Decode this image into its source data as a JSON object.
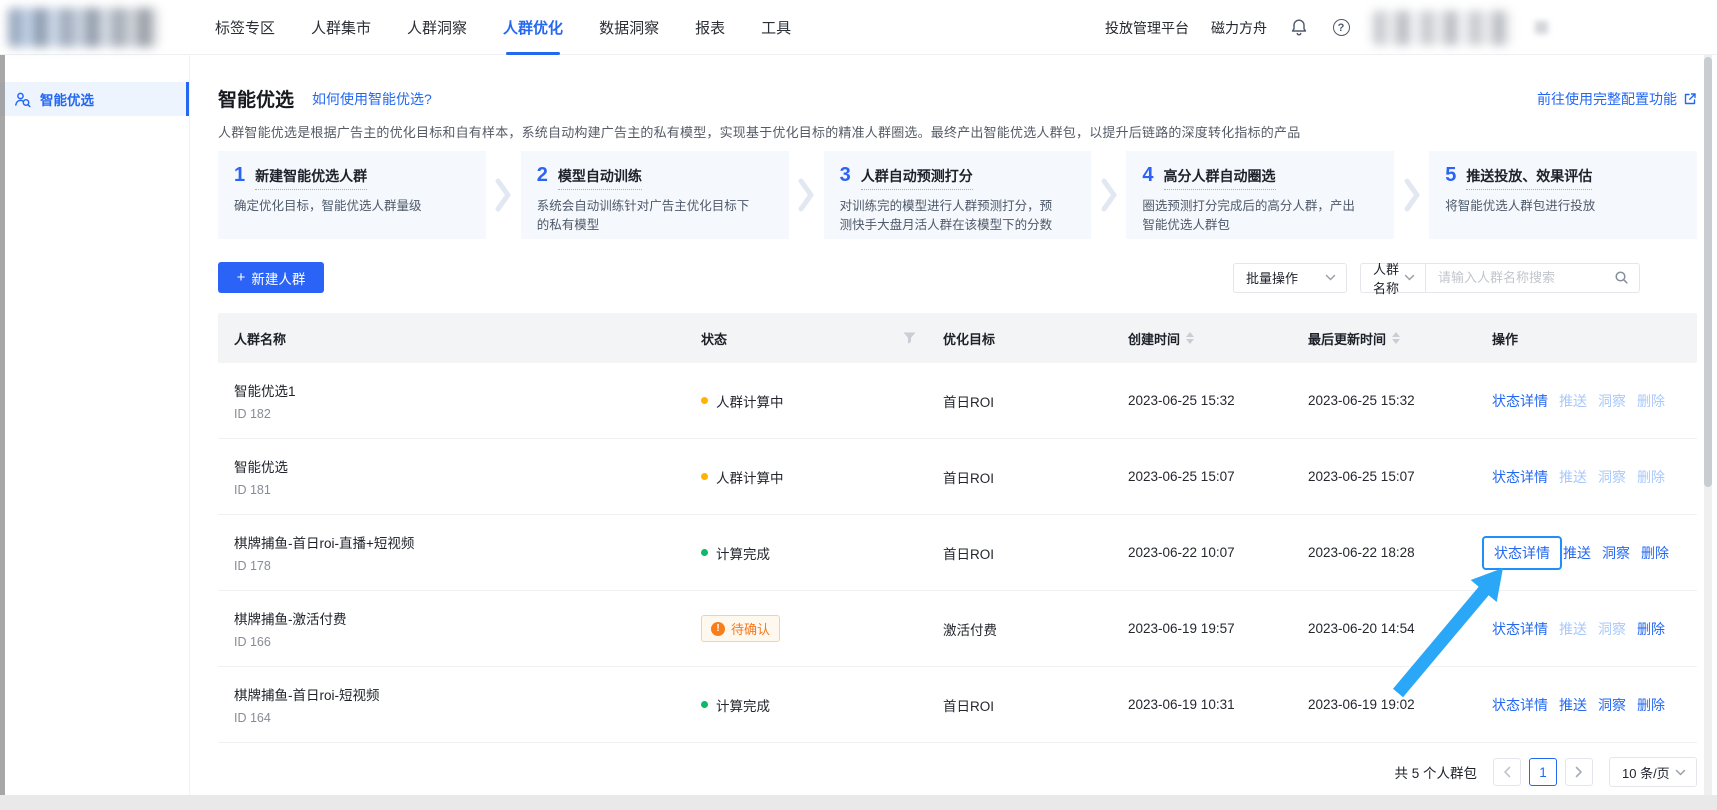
{
  "nav": {
    "tabs": [
      "标签专区",
      "人群集市",
      "人群洞察",
      "人群优化",
      "数据洞察",
      "报表",
      "工具"
    ],
    "active_index": 3,
    "platform_links": [
      "投放管理平台",
      "磁力方舟"
    ],
    "icons": {
      "notification": "bell",
      "help": "question-circle"
    }
  },
  "sidebar": {
    "items": [
      {
        "label": "智能优选",
        "active": true
      }
    ]
  },
  "main": {
    "title": "智能优选",
    "help_link": "如何使用智能优选?",
    "config_link": "前往使用完整配置功能",
    "description": "人群智能优选是根据广告主的优化目标和自有样本，系统自动构建广告主的私有模型，实现基于优化目标的精准人群圈选。最终产出智能优选人群包，以提升后链路的深度转化指标的产品",
    "steps": [
      {
        "num": "1",
        "title": "新建智能优选人群",
        "desc": "确定优化目标，智能优选人群量级"
      },
      {
        "num": "2",
        "title": "模型自动训练",
        "desc": "系统会自动训练针对广告主优化目标下的私有模型"
      },
      {
        "num": "3",
        "title": "人群自动预测打分",
        "desc": "对训练完的模型进行人群预测打分，预测快手大盘月活人群在该模型下的分数"
      },
      {
        "num": "4",
        "title": "高分人群自动圈选",
        "desc": "圈选预测打分完成后的高分人群，产出智能优选人群包"
      },
      {
        "num": "5",
        "title": "推送投放、效果评估",
        "desc": "将智能优选人群包进行投放"
      }
    ],
    "toolbar": {
      "create_button": "新建人群",
      "batch_label": "批量操作",
      "field_label": "人群名称",
      "search_placeholder": "请输入人群名称搜索"
    },
    "table": {
      "columns": [
        {
          "label": "人群名称"
        },
        {
          "label": "状态",
          "filter": true
        },
        {
          "label": "优化目标"
        },
        {
          "label": "创建时间",
          "sortable": true
        },
        {
          "label": "最后更新时间",
          "sortable": true
        },
        {
          "label": "操作"
        }
      ],
      "rows": [
        {
          "name": "智能优选1",
          "id": "ID 182",
          "status": {
            "text": "人群计算中",
            "type": "running",
            "color": "#ffb105"
          },
          "goal": "首日ROI",
          "created": "2023-06-25 15:32",
          "updated": "2023-06-25 15:32",
          "actions": [
            {
              "label": "状态详情",
              "enabled": true
            },
            {
              "label": "推送",
              "enabled": false
            },
            {
              "label": "洞察",
              "enabled": false
            },
            {
              "label": "删除",
              "enabled": false
            }
          ]
        },
        {
          "name": "智能优选",
          "id": "ID 181",
          "status": {
            "text": "人群计算中",
            "type": "running",
            "color": "#ffb105"
          },
          "goal": "首日ROI",
          "created": "2023-06-25 15:07",
          "updated": "2023-06-25 15:07",
          "actions": [
            {
              "label": "状态详情",
              "enabled": true
            },
            {
              "label": "推送",
              "enabled": false
            },
            {
              "label": "洞察",
              "enabled": false
            },
            {
              "label": "删除",
              "enabled": false
            }
          ]
        },
        {
          "name": "棋牌捕鱼-首日roi-直播+短视频",
          "id": "ID 178",
          "status": {
            "text": "计算完成",
            "type": "done",
            "color": "#12b76a"
          },
          "goal": "首日ROI",
          "created": "2023-06-22 10:07",
          "updated": "2023-06-22 18:28",
          "actions": [
            {
              "label": "状态详情",
              "enabled": true,
              "highlighted": true
            },
            {
              "label": "推送",
              "enabled": true
            },
            {
              "label": "洞察",
              "enabled": true
            },
            {
              "label": "删除",
              "enabled": true
            }
          ]
        },
        {
          "name": "棋牌捕鱼-激活付费",
          "id": "ID 166",
          "status": {
            "text": "待确认",
            "type": "warning",
            "color": "#f77e1a"
          },
          "goal": "激活付费",
          "created": "2023-06-19 19:57",
          "updated": "2023-06-20 14:54",
          "actions": [
            {
              "label": "状态详情",
              "enabled": true
            },
            {
              "label": "推送",
              "enabled": false
            },
            {
              "label": "洞察",
              "enabled": false
            },
            {
              "label": "删除",
              "enabled": true
            }
          ]
        },
        {
          "name": "棋牌捕鱼-首日roi-短视频",
          "id": "ID 164",
          "status": {
            "text": "计算完成",
            "type": "done",
            "color": "#12b76a"
          },
          "goal": "首日ROI",
          "created": "2023-06-19 10:31",
          "updated": "2023-06-19 19:02",
          "actions": [
            {
              "label": "状态详情",
              "enabled": true
            },
            {
              "label": "推送",
              "enabled": true
            },
            {
              "label": "洞察",
              "enabled": true
            },
            {
              "label": "删除",
              "enabled": true
            }
          ]
        }
      ]
    },
    "footer": {
      "total": "共 5 个人群包",
      "page": "1",
      "page_size": "10 条/页"
    }
  },
  "colors": {
    "primary": "#2a63f6",
    "link_disabled": "#a9c8fa",
    "status_running": "#ffb105",
    "status_done": "#12b76a",
    "warning": "#f77e1a",
    "annotation_arrow": "#2aa7f7",
    "highlight_border": "#1f8ffb"
  }
}
